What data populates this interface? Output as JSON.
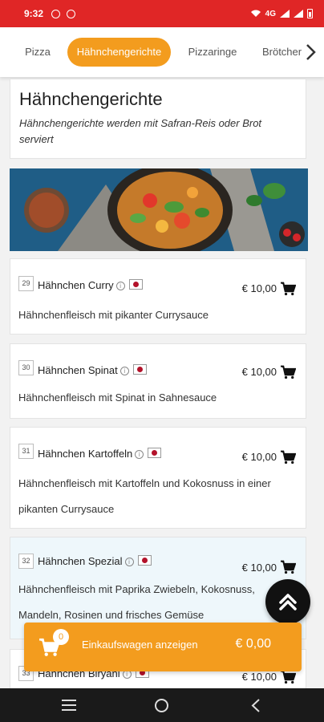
{
  "status": {
    "time": "9:32",
    "network": "4G"
  },
  "categories": [
    {
      "label": "Pizza",
      "active": false
    },
    {
      "label": "Hähnchengerichte",
      "active": true
    },
    {
      "label": "Pizzaringe",
      "active": false
    },
    {
      "label": "Brötchen",
      "active": false
    }
  ],
  "section": {
    "title": "Hähnchengerichte",
    "subtitle": "Hähnchengerichte werden mit Safran-Reis oder Brot serviert"
  },
  "items": [
    {
      "number": "29",
      "name": "Hähnchen Curry",
      "price": "€ 10,00",
      "description": "Hähnchenfleisch mit pikanter Currysauce"
    },
    {
      "number": "30",
      "name": "Hähnchen Spinat",
      "price": "€ 10,00",
      "description": "Hähnchenfleisch mit Spinat in Sahnesauce"
    },
    {
      "number": "31",
      "name": "Hähnchen Kartoffeln",
      "price": "€ 10,00",
      "description": "Hähnchenfleisch mit Kartoffeln und Kokosnuss in einer pikanten Currysauce"
    },
    {
      "number": "32",
      "name": "Hähnchen Spezial",
      "price": "€ 10,00",
      "description": "Hähnchenfleisch mit Paprika Zwiebeln, Kokosnuss, Mandeln, Rosinen und frisches Gemüse"
    },
    {
      "number": "33",
      "name": "Hähnchen Biryani",
      "price": "€ 10,00",
      "description": ""
    }
  ],
  "cart": {
    "count": "0",
    "label": "Einkaufswagen anzeigen",
    "total": "€ 0,00"
  },
  "colors": {
    "statusbar": "#e02626",
    "accent": "#f39c1e",
    "fab": "#111111"
  },
  "icons": {
    "cart": "cart-icon",
    "fab": "double-chevron-up-icon",
    "next": "chevron-right-icon",
    "info": "info-icon",
    "flag": "japan-flag-icon"
  }
}
